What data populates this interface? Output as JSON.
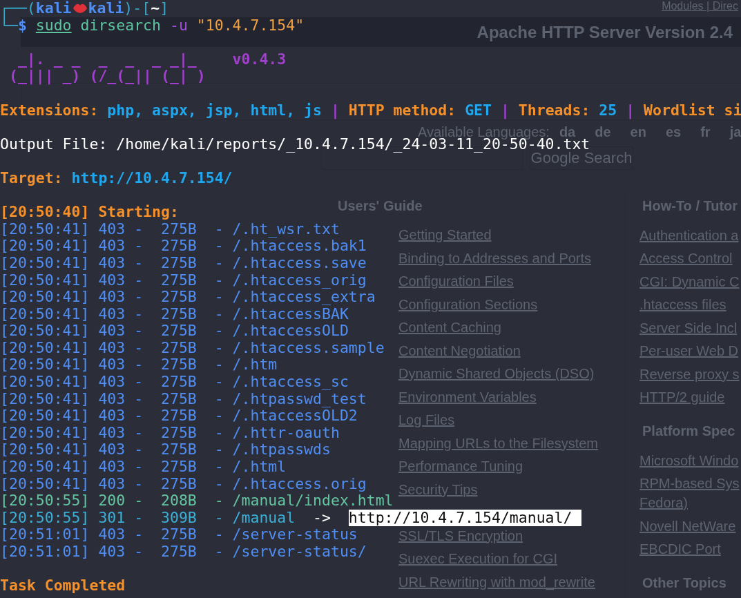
{
  "webpage": {
    "top_links": "Modules | Direc",
    "header": {
      "right": "Apache HTTP Server Version 2.4"
    },
    "languages": {
      "label": "Available Languages:",
      "items": [
        "da",
        "de",
        "en",
        "es",
        "fr",
        "ja"
      ]
    },
    "search": {
      "button": "Google Search"
    },
    "columns": [
      {
        "sections": [
          {
            "heading": "Users' Guide",
            "links": [
              "Getting Started",
              "Binding to Addresses and Ports",
              "Configuration Files",
              "Configuration Sections",
              "Content Caching",
              "Content Negotiation",
              "Dynamic Shared Objects (DSO)",
              "Environment Variables",
              "Log Files",
              "Mapping URLs to the Filesystem",
              "Performance Tuning",
              "Security Tips",
              "SSL/TLS Encryption",
              "Suexec Execution for CGI",
              "URL Rewriting with mod_rewrite"
            ]
          }
        ]
      },
      {
        "sections": [
          {
            "heading": "How-To / Tutor",
            "links": [
              "Authentication a",
              "Access Control",
              "CGI: Dynamic C",
              ".htaccess files",
              "Server Side Incl",
              "Per-user Web D",
              "Reverse proxy s",
              "HTTP/2 guide"
            ]
          },
          {
            "heading": "Platform Spec",
            "links": [
              "Microsoft Windo",
              "RPM-based Sys Fedora)",
              "Novell NetWare",
              "EBCDIC Port"
            ]
          },
          {
            "heading": "Other Topics"
          }
        ]
      }
    ]
  },
  "terminal": {
    "blocks": [
      {
        "lines": [
          {
            "segments": [
              {
                "text": "┌──(",
                "color": "#3aa7c8",
                "bold": false
              },
              {
                "text": "kali",
                "color": "#4f8ef5",
                "bold": true
              },
              {
                "kind": "lips",
                "color": "#e0303a"
              },
              {
                "text": "kali",
                "color": "#4f8ef5",
                "bold": true
              },
              {
                "text": ")-[",
                "color": "#3aa7c8",
                "bold": false
              },
              {
                "text": "~",
                "color": "#ffffff",
                "bold": true
              },
              {
                "text": "]",
                "color": "#3aa7c8",
                "bold": false
              }
            ]
          },
          {
            "segments": [
              {
                "text": "└─",
                "color": "#3aa7c8"
              },
              {
                "text": "$ ",
                "color": "#4f8ef5",
                "bold": true
              },
              {
                "text": "sudo",
                "color": "#5ec4a0",
                "bold": false,
                "underline": true
              },
              {
                "text": " dirsearch ",
                "color": "#5ec4a0",
                "bold": false
              },
              {
                "text": "-u ",
                "color": "#a050d8",
                "bold": false
              },
              {
                "text": "\"10.4.7.154\"",
                "color": "#f0a040",
                "bold": false
              }
            ]
          }
        ]
      },
      {
        "lines": [
          {
            "segments": [
              {
                "text": "  _|. _ _  _  _  _ _|_    v0.4.3",
                "color": "#a33fd0",
                "bold": true
              }
            ]
          },
          {
            "segments": [
              {
                "text": " (_||| _) (/_(_|| (_| )",
                "color": "#a33fd0",
                "bold": true
              }
            ]
          }
        ]
      },
      {
        "lines": [
          {
            "segments": [
              {
                "text": "Extensions: ",
                "color": "#f5902a",
                "bold": true
              },
              {
                "text": "php, aspx, jsp, html, js",
                "color": "#1fa8f0",
                "bold": true
              },
              {
                "text": " | ",
                "color": "#a33fd0",
                "bold": true
              },
              {
                "text": "HTTP method: ",
                "color": "#f5902a",
                "bold": true
              },
              {
                "text": "GET",
                "color": "#1fa8f0",
                "bold": true
              },
              {
                "text": " | ",
                "color": "#a33fd0",
                "bold": true
              },
              {
                "text": "Threads: ",
                "color": "#f5902a",
                "bold": true
              },
              {
                "text": "25",
                "color": "#1fa8f0",
                "bold": true
              },
              {
                "text": " | ",
                "color": "#a33fd0",
                "bold": true
              },
              {
                "text": "Wordlist si",
                "color": "#f5902a",
                "bold": true
              }
            ]
          }
        ]
      },
      {
        "lines": [
          {
            "segments": [
              {
                "text": "Output File: /home/kali/reports/_10.4.7.154/_24-03-11_20-50-40.txt",
                "color": "#ffffff",
                "bold": false
              }
            ]
          }
        ]
      },
      {
        "lines": [
          {
            "segments": [
              {
                "text": "Target: ",
                "color": "#f5902a",
                "bold": true
              },
              {
                "text": "http://10.4.7.154/",
                "color": "#1fa8f0",
                "bold": true
              }
            ]
          }
        ]
      },
      {
        "lines": [
          {
            "segments": [
              {
                "text": "[20:50:40] Starting:",
                "color": "#f5902a",
                "bold": true
              }
            ]
          },
          {
            "segments": [
              {
                "text": "[20:50:41] 403 -  275B  - /.ht_wsr.txt",
                "color": "#4f8ef5",
                "bold": false
              }
            ]
          },
          {
            "segments": [
              {
                "text": "[20:50:41] 403 -  275B  - /.htaccess.bak1",
                "color": "#4f8ef5",
                "bold": false
              }
            ]
          },
          {
            "segments": [
              {
                "text": "[20:50:41] 403 -  275B  - /.htaccess.save",
                "color": "#4f8ef5",
                "bold": false
              }
            ]
          },
          {
            "segments": [
              {
                "text": "[20:50:41] 403 -  275B  - /.htaccess_orig",
                "color": "#4f8ef5",
                "bold": false
              }
            ]
          },
          {
            "segments": [
              {
                "text": "[20:50:41] 403 -  275B  - /.htaccess_extra",
                "color": "#4f8ef5",
                "bold": false
              }
            ]
          },
          {
            "segments": [
              {
                "text": "[20:50:41] 403 -  275B  - /.htaccessBAK",
                "color": "#4f8ef5",
                "bold": false
              }
            ]
          },
          {
            "segments": [
              {
                "text": "[20:50:41] 403 -  275B  - /.htaccessOLD",
                "color": "#4f8ef5",
                "bold": false
              }
            ]
          },
          {
            "segments": [
              {
                "text": "[20:50:41] 403 -  275B  - /.htaccess.sample",
                "color": "#4f8ef5",
                "bold": false
              }
            ]
          },
          {
            "segments": [
              {
                "text": "[20:50:41] 403 -  275B  - /.htm",
                "color": "#4f8ef5",
                "bold": false
              }
            ]
          },
          {
            "segments": [
              {
                "text": "[20:50:41] 403 -  275B  - /.htaccess_sc",
                "color": "#4f8ef5",
                "bold": false
              }
            ]
          },
          {
            "segments": [
              {
                "text": "[20:50:41] 403 -  275B  - /.htpasswd_test",
                "color": "#4f8ef5",
                "bold": false
              }
            ]
          },
          {
            "segments": [
              {
                "text": "[20:50:41] 403 -  275B  - /.htaccessOLD2",
                "color": "#4f8ef5",
                "bold": false
              }
            ]
          },
          {
            "segments": [
              {
                "text": "[20:50:41] 403 -  275B  - /.httr-oauth",
                "color": "#4f8ef5",
                "bold": false
              }
            ]
          },
          {
            "segments": [
              {
                "text": "[20:50:41] 403 -  275B  - /.htpasswds",
                "color": "#4f8ef5",
                "bold": false
              }
            ]
          },
          {
            "segments": [
              {
                "text": "[20:50:41] 403 -  275B  - /.html",
                "color": "#4f8ef5",
                "bold": false
              }
            ]
          },
          {
            "segments": [
              {
                "text": "[20:50:41] 403 -  275B  - /.htaccess.orig",
                "color": "#4f8ef5",
                "bold": false
              }
            ]
          },
          {
            "segments": [
              {
                "text": "[20:50:55] 200 -  208B  - /manual/index.html",
                "color": "#63c5a0",
                "bold": false
              }
            ]
          },
          {
            "segments": [
              {
                "text": "[20:50:55] 301 -  309B  - /manual",
                "color": "#3ab0d8",
                "bold": false
              },
              {
                "text": "  ->  ",
                "color": "#ffffff",
                "bold": false
              },
              {
                "text": "http://10.4.7.154/manual/",
                "color": "#111111",
                "bold": false,
                "highlight": true
              }
            ]
          },
          {
            "segments": [
              {
                "text": "[20:51:01] 403 -  275B  - /server-status",
                "color": "#4f8ef5",
                "bold": false
              }
            ]
          },
          {
            "segments": [
              {
                "text": "[20:51:01] 403 -  275B  - /server-status/",
                "color": "#4f8ef5",
                "bold": false
              }
            ]
          }
        ]
      },
      {
        "lines": [
          {
            "segments": [
              {
                "text": "Task Completed",
                "color": "#f5902a",
                "bold": true
              }
            ]
          }
        ]
      }
    ]
  }
}
